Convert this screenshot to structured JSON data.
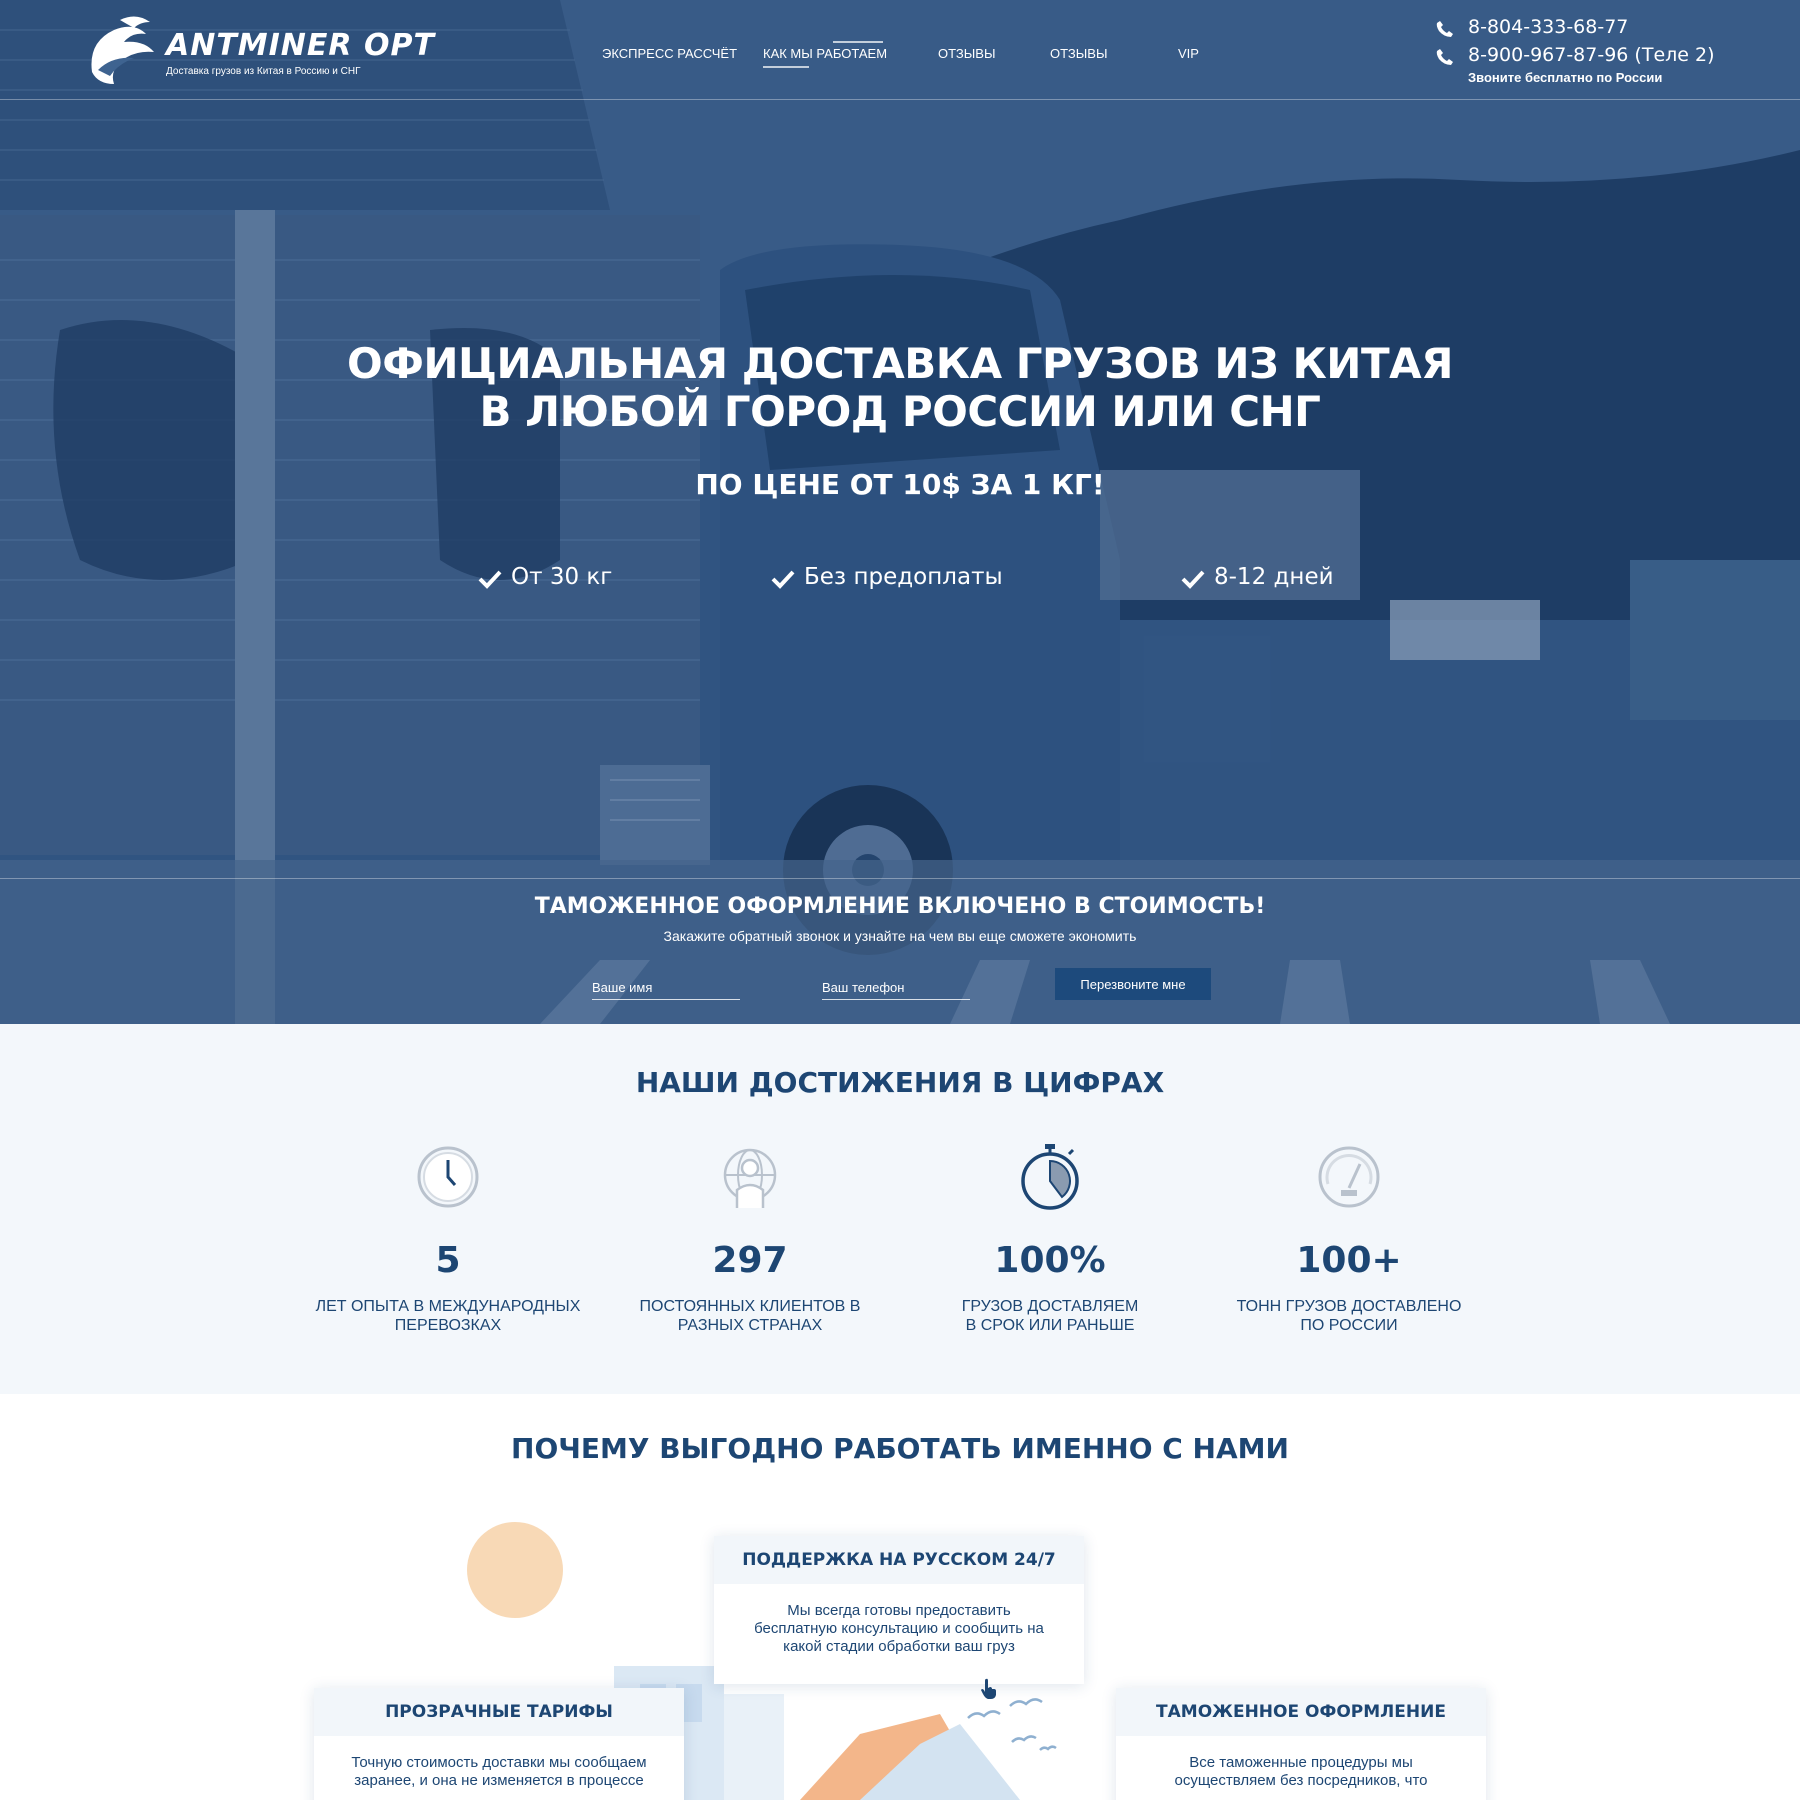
{
  "header": {
    "logo_name": "ANTMINER OPT",
    "logo_tagline": "Доставка грузов из Китая в Россию и СНГ",
    "nav": [
      {
        "label": "ЭКСПРЕСС РАССЧЁТ"
      },
      {
        "label": "КАК МЫ РАБОТАЕМ",
        "active": true
      },
      {
        "label": "ОТЗЫВЫ"
      },
      {
        "label": "ОТЗЫВЫ"
      },
      {
        "label": "VIP"
      }
    ],
    "phones": [
      "8-804-333-68-77",
      "8-900-967-87-96 (Теле 2)"
    ],
    "phone_note": "Звоните бесплатно по России"
  },
  "hero": {
    "title_line1": "ОФИЦИАЛЬНАЯ ДОСТАВКА ГРУЗОВ ИЗ КИТАЯ",
    "title_line2": "В ЛЮБОЙ ГОРОД РОССИИ ИЛИ СНГ",
    "subtitle": "ПО ЦЕНЕ ОТ 10$ ЗА 1 КГ!",
    "features": [
      "От 30 кг",
      "Без предоплаты",
      "8-12 дней"
    ],
    "customs_title": "ТАМОЖЕННОЕ ОФОРМЛЕНИЕ ВКЛЮЧЕНО В СТОИМОСТЬ!",
    "customs_subtitle": "Закажите обратный звонок и узнайте на чем вы еще сможете экономить",
    "name_placeholder": "Ваше имя",
    "phone_placeholder": "Ваш телефон",
    "callback_button": "Перезвоните мне"
  },
  "stats": {
    "title": "НАШИ ДОСТИЖЕНИЯ В ЦИФРАХ",
    "items": [
      {
        "icon": "clock-icon",
        "value": "5",
        "label_line1": "ЛЕТ ОПЫТА В МЕЖДУНАРОДНЫХ",
        "label_line2": "ПЕРЕВОЗКАХ"
      },
      {
        "icon": "globe-person-icon",
        "value": "297",
        "label_line1": "ПОСТОЯННЫХ КЛИЕНТОВ В",
        "label_line2": "РАЗНЫХ СТРАНАХ"
      },
      {
        "icon": "stopwatch-icon",
        "value": "100%",
        "label_line1": "ГРУЗОВ ДОСТАВЛЯЕМ",
        "label_line2": "В СРОК ИЛИ РАНЬШЕ"
      },
      {
        "icon": "speedometer-icon",
        "value": "100+",
        "label_line1": "ТОНН ГРУЗОВ ДОСТАВЛЕНО",
        "label_line2": "ПО РОССИИ"
      }
    ]
  },
  "why": {
    "title": "ПОЧЕМУ ВЫГОДНО РАБОТАТЬ ИМЕННО С НАМИ",
    "cards": [
      {
        "title": "ПОДДЕРЖКА НА РУССКОМ 24/7",
        "text_line1": "Мы всегда готовы предоставить",
        "text_line2": "бесплатную консультацию и сообщить на",
        "text_line3": "какой стадии обработки ваш груз"
      },
      {
        "title": "ПРОЗРАЧНЫЕ ТАРИФЫ",
        "text_line1": "Точную стоимость доставки мы сообщаем",
        "text_line2": "заранее, и она не изменяется в процессе",
        "text_line3": ""
      },
      {
        "title": "ТАМОЖЕННОЕ ОФОРМЛЕНИЕ",
        "text_line1": "Все таможенные процедуры мы",
        "text_line2": "осуществляем без посредников, что",
        "text_line3": ""
      }
    ]
  },
  "colors": {
    "brand_dark": "#1d4673",
    "button": "#1d4a7c",
    "stats_bg": "#f3f7fb",
    "accent_peach": "#f8d9b6"
  }
}
